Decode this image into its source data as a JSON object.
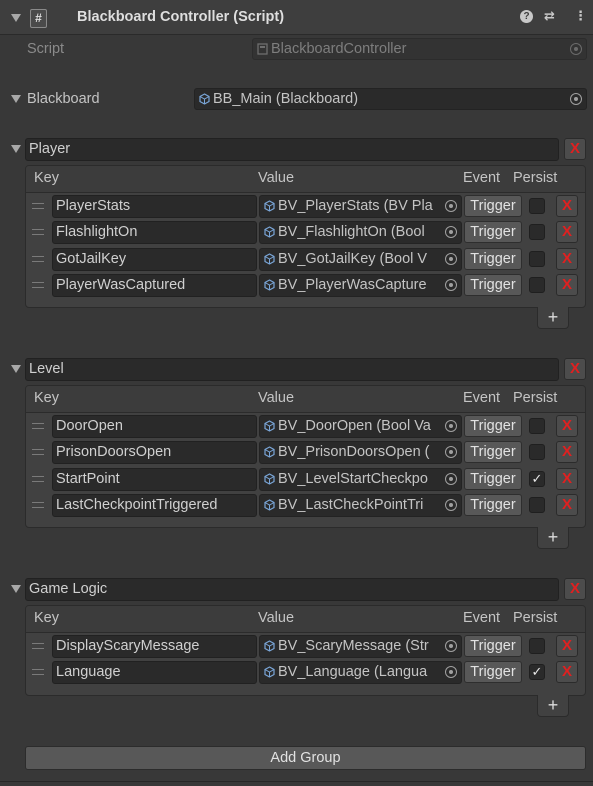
{
  "component": {
    "title": "Blackboard Controller (Script)",
    "icons": [
      "help-icon",
      "preset-icon",
      "kebab-menu-icon"
    ],
    "script_label": "Script",
    "script_value": "BlackboardController",
    "blackboard_label": "Blackboard",
    "blackboard_value": "BB_Main (Blackboard)"
  },
  "columns": {
    "key": "Key",
    "value": "Value",
    "event": "Event",
    "persist": "Persist"
  },
  "trigger_label": "Trigger",
  "remove_label": "X",
  "add_label": "+",
  "groups": [
    {
      "name": "Player",
      "rows": [
        {
          "key": "PlayerStats",
          "value": "BV_PlayerStats (BV Pla",
          "persist": false
        },
        {
          "key": "FlashlightOn",
          "value": "BV_FlashlightOn (Bool",
          "persist": false
        },
        {
          "key": "GotJailKey",
          "value": "BV_GotJailKey (Bool V",
          "persist": false
        },
        {
          "key": "PlayerWasCaptured",
          "value": "BV_PlayerWasCapture",
          "persist": false
        }
      ]
    },
    {
      "name": "Level",
      "rows": [
        {
          "key": "DoorOpen",
          "value": "BV_DoorOpen (Bool Va",
          "persist": false
        },
        {
          "key": "PrisonDoorsOpen",
          "value": "BV_PrisonDoorsOpen (",
          "persist": false
        },
        {
          "key": "StartPoint",
          "value": "BV_LevelStartCheckpo",
          "persist": true
        },
        {
          "key": "LastCheckpointTriggered",
          "value": "BV_LastCheckPointTri",
          "persist": false
        }
      ]
    },
    {
      "name": "Game Logic",
      "rows": [
        {
          "key": "DisplayScaryMessage",
          "value": "BV_ScaryMessage (Str",
          "persist": false
        },
        {
          "key": "Language",
          "value": "BV_Language (Langua",
          "persist": true
        }
      ]
    }
  ],
  "add_group_label": "Add Group",
  "colors": {
    "background": "#383838",
    "remove_x": "#e02020",
    "field": "#2a2a2a"
  }
}
